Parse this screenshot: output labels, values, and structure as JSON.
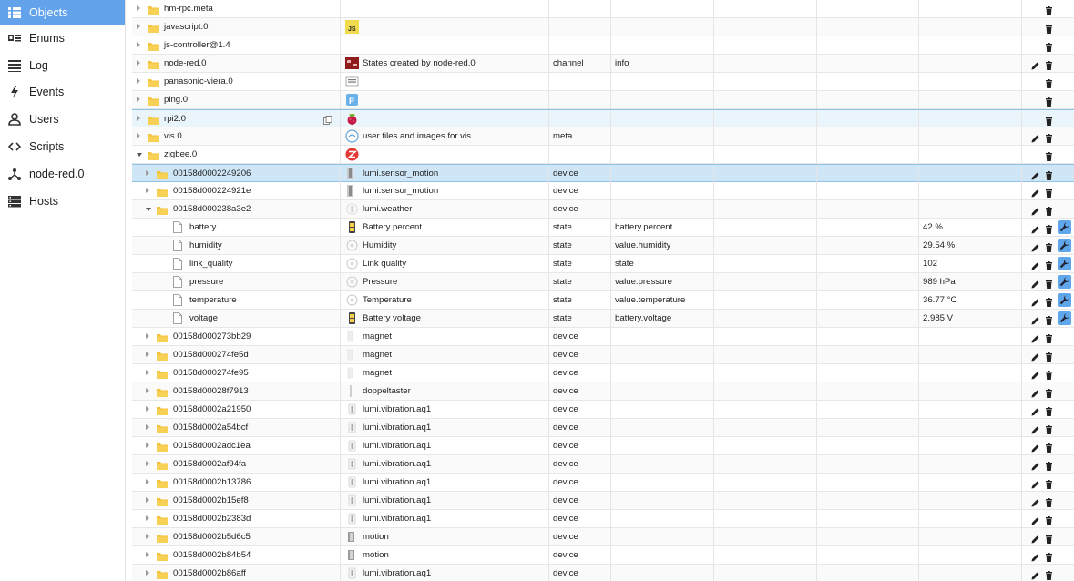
{
  "sidebar": {
    "items": [
      {
        "label": "Objects",
        "icon": "list-icon",
        "active": true
      },
      {
        "label": "Enums",
        "icon": "enum-icon"
      },
      {
        "label": "Log",
        "icon": "log-icon"
      },
      {
        "label": "Events",
        "icon": "bolt-icon"
      },
      {
        "label": "Users",
        "icon": "user-icon"
      },
      {
        "label": "Scripts",
        "icon": "code-icon"
      },
      {
        "label": "node-red.0",
        "icon": "nodes-icon"
      },
      {
        "label": "Hosts",
        "icon": "server-icon"
      }
    ]
  },
  "objects": {
    "rows": [
      {
        "id": "hm-rpc.meta",
        "level": 0,
        "kind": "folder",
        "expand": "collapsed",
        "name": "",
        "icon": "",
        "type": "",
        "role": "",
        "value": "",
        "edit": false,
        "wrench": false
      },
      {
        "id": "javascript.0",
        "level": 0,
        "kind": "folder",
        "expand": "collapsed",
        "name": "",
        "icon": "js-icon",
        "type": "",
        "role": "",
        "value": "",
        "edit": false,
        "wrench": false
      },
      {
        "id": "js-controller@1.4",
        "level": 0,
        "kind": "folder",
        "expand": "collapsed",
        "name": "",
        "icon": "",
        "type": "",
        "role": "",
        "value": "",
        "edit": false,
        "wrench": false
      },
      {
        "id": "node-red.0",
        "level": 0,
        "kind": "folder",
        "expand": "collapsed",
        "name": "States created by node-red.0",
        "icon": "node-red-icon",
        "type": "channel",
        "role": "info",
        "value": "",
        "edit": true,
        "wrench": false
      },
      {
        "id": "panasonic-viera.0",
        "level": 0,
        "kind": "folder",
        "expand": "collapsed",
        "name": "",
        "icon": "tv-remote-icon",
        "type": "",
        "role": "",
        "value": "",
        "edit": false,
        "wrench": false
      },
      {
        "id": "ping.0",
        "level": 0,
        "kind": "folder",
        "expand": "collapsed",
        "name": "",
        "icon": "ping-icon",
        "type": "",
        "role": "",
        "value": "",
        "edit": false,
        "wrench": false
      },
      {
        "id": "rpi2.0",
        "level": 0,
        "kind": "folder",
        "expand": "collapsed",
        "name": "",
        "icon": "raspberry-icon",
        "type": "",
        "role": "",
        "value": "",
        "edit": false,
        "wrench": false,
        "hover": true
      },
      {
        "id": "vis.0",
        "level": 0,
        "kind": "folder",
        "expand": "collapsed",
        "name": "user files and images for vis",
        "icon": "vis-icon",
        "type": "meta",
        "role": "",
        "value": "",
        "edit": true,
        "wrench": false
      },
      {
        "id": "zigbee.0",
        "level": 0,
        "kind": "folder",
        "expand": "expanded",
        "name": "",
        "icon": "zigbee-icon",
        "type": "",
        "role": "",
        "value": "",
        "edit": false,
        "wrench": false
      },
      {
        "id": "00158d0002249206",
        "level": 1,
        "kind": "folder",
        "expand": "collapsed",
        "name": "lumi.sensor_motion",
        "icon": "device-icon",
        "type": "device",
        "role": "",
        "value": "",
        "edit": true,
        "wrench": false,
        "selected": true
      },
      {
        "id": "00158d000224921e",
        "level": 1,
        "kind": "folder",
        "expand": "collapsed",
        "name": "lumi.sensor_motion",
        "icon": "device-icon",
        "type": "device",
        "role": "",
        "value": "",
        "edit": true,
        "wrench": false
      },
      {
        "id": "00158d000238a3e2",
        "level": 1,
        "kind": "folder",
        "expand": "expanded",
        "name": "lumi.weather",
        "icon": "weather-icon",
        "type": "device",
        "role": "",
        "value": "",
        "edit": true,
        "wrench": false
      },
      {
        "id": "battery",
        "level": 2,
        "kind": "file",
        "expand": "none",
        "name": "Battery percent",
        "icon": "battery-icon",
        "type": "state",
        "role": "battery.percent",
        "value": "42 %",
        "edit": true,
        "wrench": true
      },
      {
        "id": "humidity",
        "level": 2,
        "kind": "file",
        "expand": "none",
        "name": "Humidity",
        "icon": "state-icon",
        "type": "state",
        "role": "value.humidity",
        "value": "29.54 %",
        "edit": true,
        "wrench": true
      },
      {
        "id": "link_quality",
        "level": 2,
        "kind": "file",
        "expand": "none",
        "name": "Link quality",
        "icon": "state-icon",
        "type": "state",
        "role": "state",
        "value": "102",
        "edit": true,
        "wrench": true
      },
      {
        "id": "pressure",
        "level": 2,
        "kind": "file",
        "expand": "none",
        "name": "Pressure",
        "icon": "state-icon",
        "type": "state",
        "role": "value.pressure",
        "value": "989 hPa",
        "edit": true,
        "wrench": true
      },
      {
        "id": "temperature",
        "level": 2,
        "kind": "file",
        "expand": "none",
        "name": "Temperature",
        "icon": "state-icon",
        "type": "state",
        "role": "value.temperature",
        "value": "36.77 °C",
        "edit": true,
        "wrench": true
      },
      {
        "id": "voltage",
        "level": 2,
        "kind": "file",
        "expand": "none",
        "name": "Battery voltage",
        "icon": "battery-icon",
        "type": "state",
        "role": "battery.voltage",
        "value": "2.985 V",
        "edit": true,
        "wrench": true
      },
      {
        "id": "00158d000273bb29",
        "level": 1,
        "kind": "folder",
        "expand": "collapsed",
        "name": "magnet",
        "icon": "magnet-icon",
        "type": "device",
        "role": "",
        "value": "",
        "edit": true,
        "wrench": false
      },
      {
        "id": "00158d000274fe5d",
        "level": 1,
        "kind": "folder",
        "expand": "collapsed",
        "name": "magnet",
        "icon": "magnet-icon",
        "type": "device",
        "role": "",
        "value": "",
        "edit": true,
        "wrench": false
      },
      {
        "id": "00158d000274fe95",
        "level": 1,
        "kind": "folder",
        "expand": "collapsed",
        "name": "magnet",
        "icon": "magnet-icon",
        "type": "device",
        "role": "",
        "value": "",
        "edit": true,
        "wrench": false
      },
      {
        "id": "00158d00028f7913",
        "level": 1,
        "kind": "folder",
        "expand": "collapsed",
        "name": "doppeltaster",
        "icon": "switch-icon",
        "type": "device",
        "role": "",
        "value": "",
        "edit": true,
        "wrench": false
      },
      {
        "id": "00158d0002a21950",
        "level": 1,
        "kind": "folder",
        "expand": "collapsed",
        "name": "lumi.vibration.aq1",
        "icon": "vibration-icon",
        "type": "device",
        "role": "",
        "value": "",
        "edit": true,
        "wrench": false
      },
      {
        "id": "00158d0002a54bcf",
        "level": 1,
        "kind": "folder",
        "expand": "collapsed",
        "name": "lumi.vibration.aq1",
        "icon": "vibration-icon",
        "type": "device",
        "role": "",
        "value": "",
        "edit": true,
        "wrench": false
      },
      {
        "id": "00158d0002adc1ea",
        "level": 1,
        "kind": "folder",
        "expand": "collapsed",
        "name": "lumi.vibration.aq1",
        "icon": "vibration-icon",
        "type": "device",
        "role": "",
        "value": "",
        "edit": true,
        "wrench": false
      },
      {
        "id": "00158d0002af94fa",
        "level": 1,
        "kind": "folder",
        "expand": "collapsed",
        "name": "lumi.vibration.aq1",
        "icon": "vibration-icon",
        "type": "device",
        "role": "",
        "value": "",
        "edit": true,
        "wrench": false
      },
      {
        "id": "00158d0002b13786",
        "level": 1,
        "kind": "folder",
        "expand": "collapsed",
        "name": "lumi.vibration.aq1",
        "icon": "vibration-icon",
        "type": "device",
        "role": "",
        "value": "",
        "edit": true,
        "wrench": false
      },
      {
        "id": "00158d0002b15ef8",
        "level": 1,
        "kind": "folder",
        "expand": "collapsed",
        "name": "lumi.vibration.aq1",
        "icon": "vibration-icon",
        "type": "device",
        "role": "",
        "value": "",
        "edit": true,
        "wrench": false
      },
      {
        "id": "00158d0002b2383d",
        "level": 1,
        "kind": "folder",
        "expand": "collapsed",
        "name": "lumi.vibration.aq1",
        "icon": "vibration-icon",
        "type": "device",
        "role": "",
        "value": "",
        "edit": true,
        "wrench": false
      },
      {
        "id": "00158d0002b5d6c5",
        "level": 1,
        "kind": "folder",
        "expand": "collapsed",
        "name": "motion",
        "icon": "motion-icon",
        "type": "device",
        "role": "",
        "value": "",
        "edit": true,
        "wrench": false
      },
      {
        "id": "00158d0002b84b54",
        "level": 1,
        "kind": "folder",
        "expand": "collapsed",
        "name": "motion",
        "icon": "motion-icon",
        "type": "device",
        "role": "",
        "value": "",
        "edit": true,
        "wrench": false
      },
      {
        "id": "00158d0002b86aff",
        "level": 1,
        "kind": "folder",
        "expand": "collapsed",
        "name": "lumi.vibration.aq1",
        "icon": "vibration-icon",
        "type": "device",
        "role": "",
        "value": "",
        "edit": true,
        "wrench": false
      }
    ]
  },
  "colors": {
    "accent": "#62a3ec",
    "selected_row": "#cfe6f7",
    "hover_row": "#eaf4fb",
    "folder": "#f3c23a",
    "wrench": "#5fa7ea"
  }
}
